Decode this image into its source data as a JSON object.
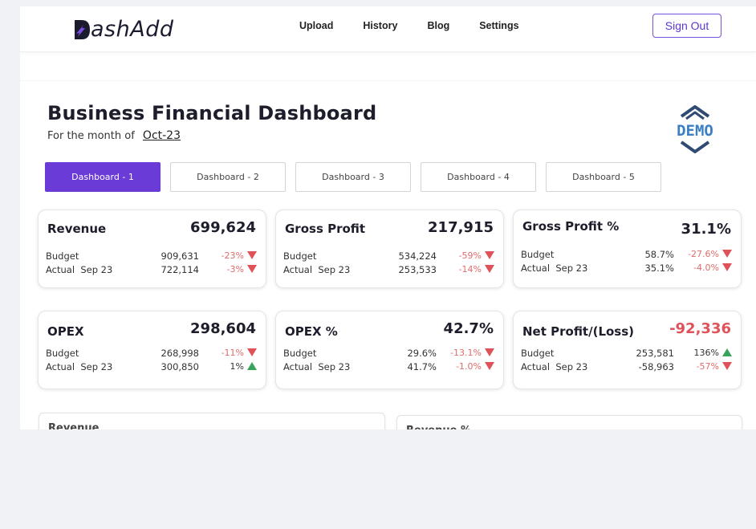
{
  "brand": {
    "name": "ashAdd",
    "initial": "D"
  },
  "nav": [
    "Upload",
    "History",
    "Blog",
    "Settings"
  ],
  "signout_label": "Sign Out",
  "page": {
    "title": "Business Financial Dashboard",
    "subtitle_prefix": "For the month of",
    "month": "Oct-23",
    "demo_badge": "DEMO"
  },
  "tabs": [
    {
      "label": "Dashboard - 1",
      "active": true
    },
    {
      "label": "Dashboard - 2",
      "active": false
    },
    {
      "label": "Dashboard - 3",
      "active": false
    },
    {
      "label": "Dashboard - 4",
      "active": false
    },
    {
      "label": "Dashboard - 5",
      "active": false
    }
  ],
  "cards": [
    {
      "title": "Revenue",
      "value": "699,624",
      "negative": false,
      "rows": [
        {
          "label": "Budget",
          "value": "909,631",
          "pct": "-23%",
          "trend": "down"
        },
        {
          "label": "Actual  Sep 23",
          "value": "722,114",
          "pct": "-3%",
          "trend": "down"
        }
      ]
    },
    {
      "title": "Gross Profit",
      "value": "217,915",
      "negative": false,
      "rows": [
        {
          "label": "Budget",
          "value": "534,224",
          "pct": "-59%",
          "trend": "down"
        },
        {
          "label": "Actual  Sep 23",
          "value": "253,533",
          "pct": "-14%",
          "trend": "down"
        }
      ]
    },
    {
      "title": "Gross Profit %",
      "value": "31.1%",
      "negative": false,
      "rows": [
        {
          "label": "Budget",
          "value": "58.7%",
          "pct": "-27.6%",
          "trend": "down"
        },
        {
          "label": "Actual  Sep 23",
          "value": "35.1%",
          "pct": "-4.0%",
          "trend": "down"
        }
      ]
    },
    {
      "title": "OPEX",
      "value": "298,604",
      "negative": false,
      "rows": [
        {
          "label": "Budget",
          "value": "268,998",
          "pct": "-11%",
          "trend": "down"
        },
        {
          "label": "Actual  Sep 23",
          "value": "300,850",
          "pct": "1%",
          "trend": "up"
        }
      ]
    },
    {
      "title": "OPEX %",
      "value": "42.7%",
      "negative": false,
      "rows": [
        {
          "label": "Budget",
          "value": "29.6%",
          "pct": "-13.1%",
          "trend": "down"
        },
        {
          "label": "Actual  Sep 23",
          "value": "41.7%",
          "pct": "-1.0%",
          "trend": "down"
        }
      ]
    },
    {
      "title": "Net Profit/(Loss)",
      "value": "-92,336",
      "negative": true,
      "rows": [
        {
          "label": "Budget",
          "value": "253,581",
          "pct": "136%",
          "trend": "up"
        },
        {
          "label": "Actual  Sep 23",
          "value": "-58,963",
          "pct": "-57%",
          "trend": "down"
        }
      ]
    }
  ],
  "panels": [
    "Revenue",
    "Revenue %"
  ],
  "colors": {
    "accent": "#6a3bd6",
    "negative": "#e0525a",
    "down_arrow": "#e0525a",
    "up_arrow": "#3aa35b",
    "badge": "#3b7fc4"
  }
}
